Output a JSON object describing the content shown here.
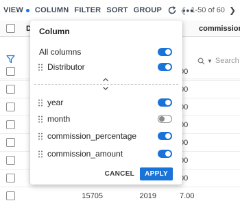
{
  "toolbar": {
    "view_label": "VIEW",
    "column_label": "COLUMN",
    "filter_label": "FILTER",
    "sort_label": "SORT",
    "group_label": "GROUP",
    "more_label": "•••",
    "pagination_label": "1-50 of 60",
    "prev_icon": "chevron-left-icon",
    "next_icon": "chevron-right-icon",
    "view_dot_color": "#1a73d9"
  },
  "grid": {
    "header_first_col": "D",
    "header_last_col": "commission_",
    "search_placeholder": "Search",
    "rows": [
      {
        "v3": "00"
      },
      {
        "v3": "00"
      },
      {
        "v3": "00"
      },
      {
        "v3": "00"
      },
      {
        "v3": "00"
      },
      {
        "v3": "00"
      },
      {
        "v3": "00"
      },
      {
        "v1": "15705",
        "v2": "2019",
        "v3": "7.00"
      }
    ]
  },
  "column_popover": {
    "title": "Column",
    "all_columns_label": "All columns",
    "all_columns_enabled": true,
    "pinned": [
      {
        "label": "Distributor",
        "enabled": true
      }
    ],
    "columns": [
      {
        "label": "year",
        "enabled": true
      },
      {
        "label": "month",
        "enabled": false
      },
      {
        "label": "commission_percentage",
        "enabled": true
      },
      {
        "label": "commission_amount",
        "enabled": true
      }
    ],
    "cancel_label": "CANCEL",
    "apply_label": "APPLY",
    "accent_color": "#1a73d9"
  }
}
